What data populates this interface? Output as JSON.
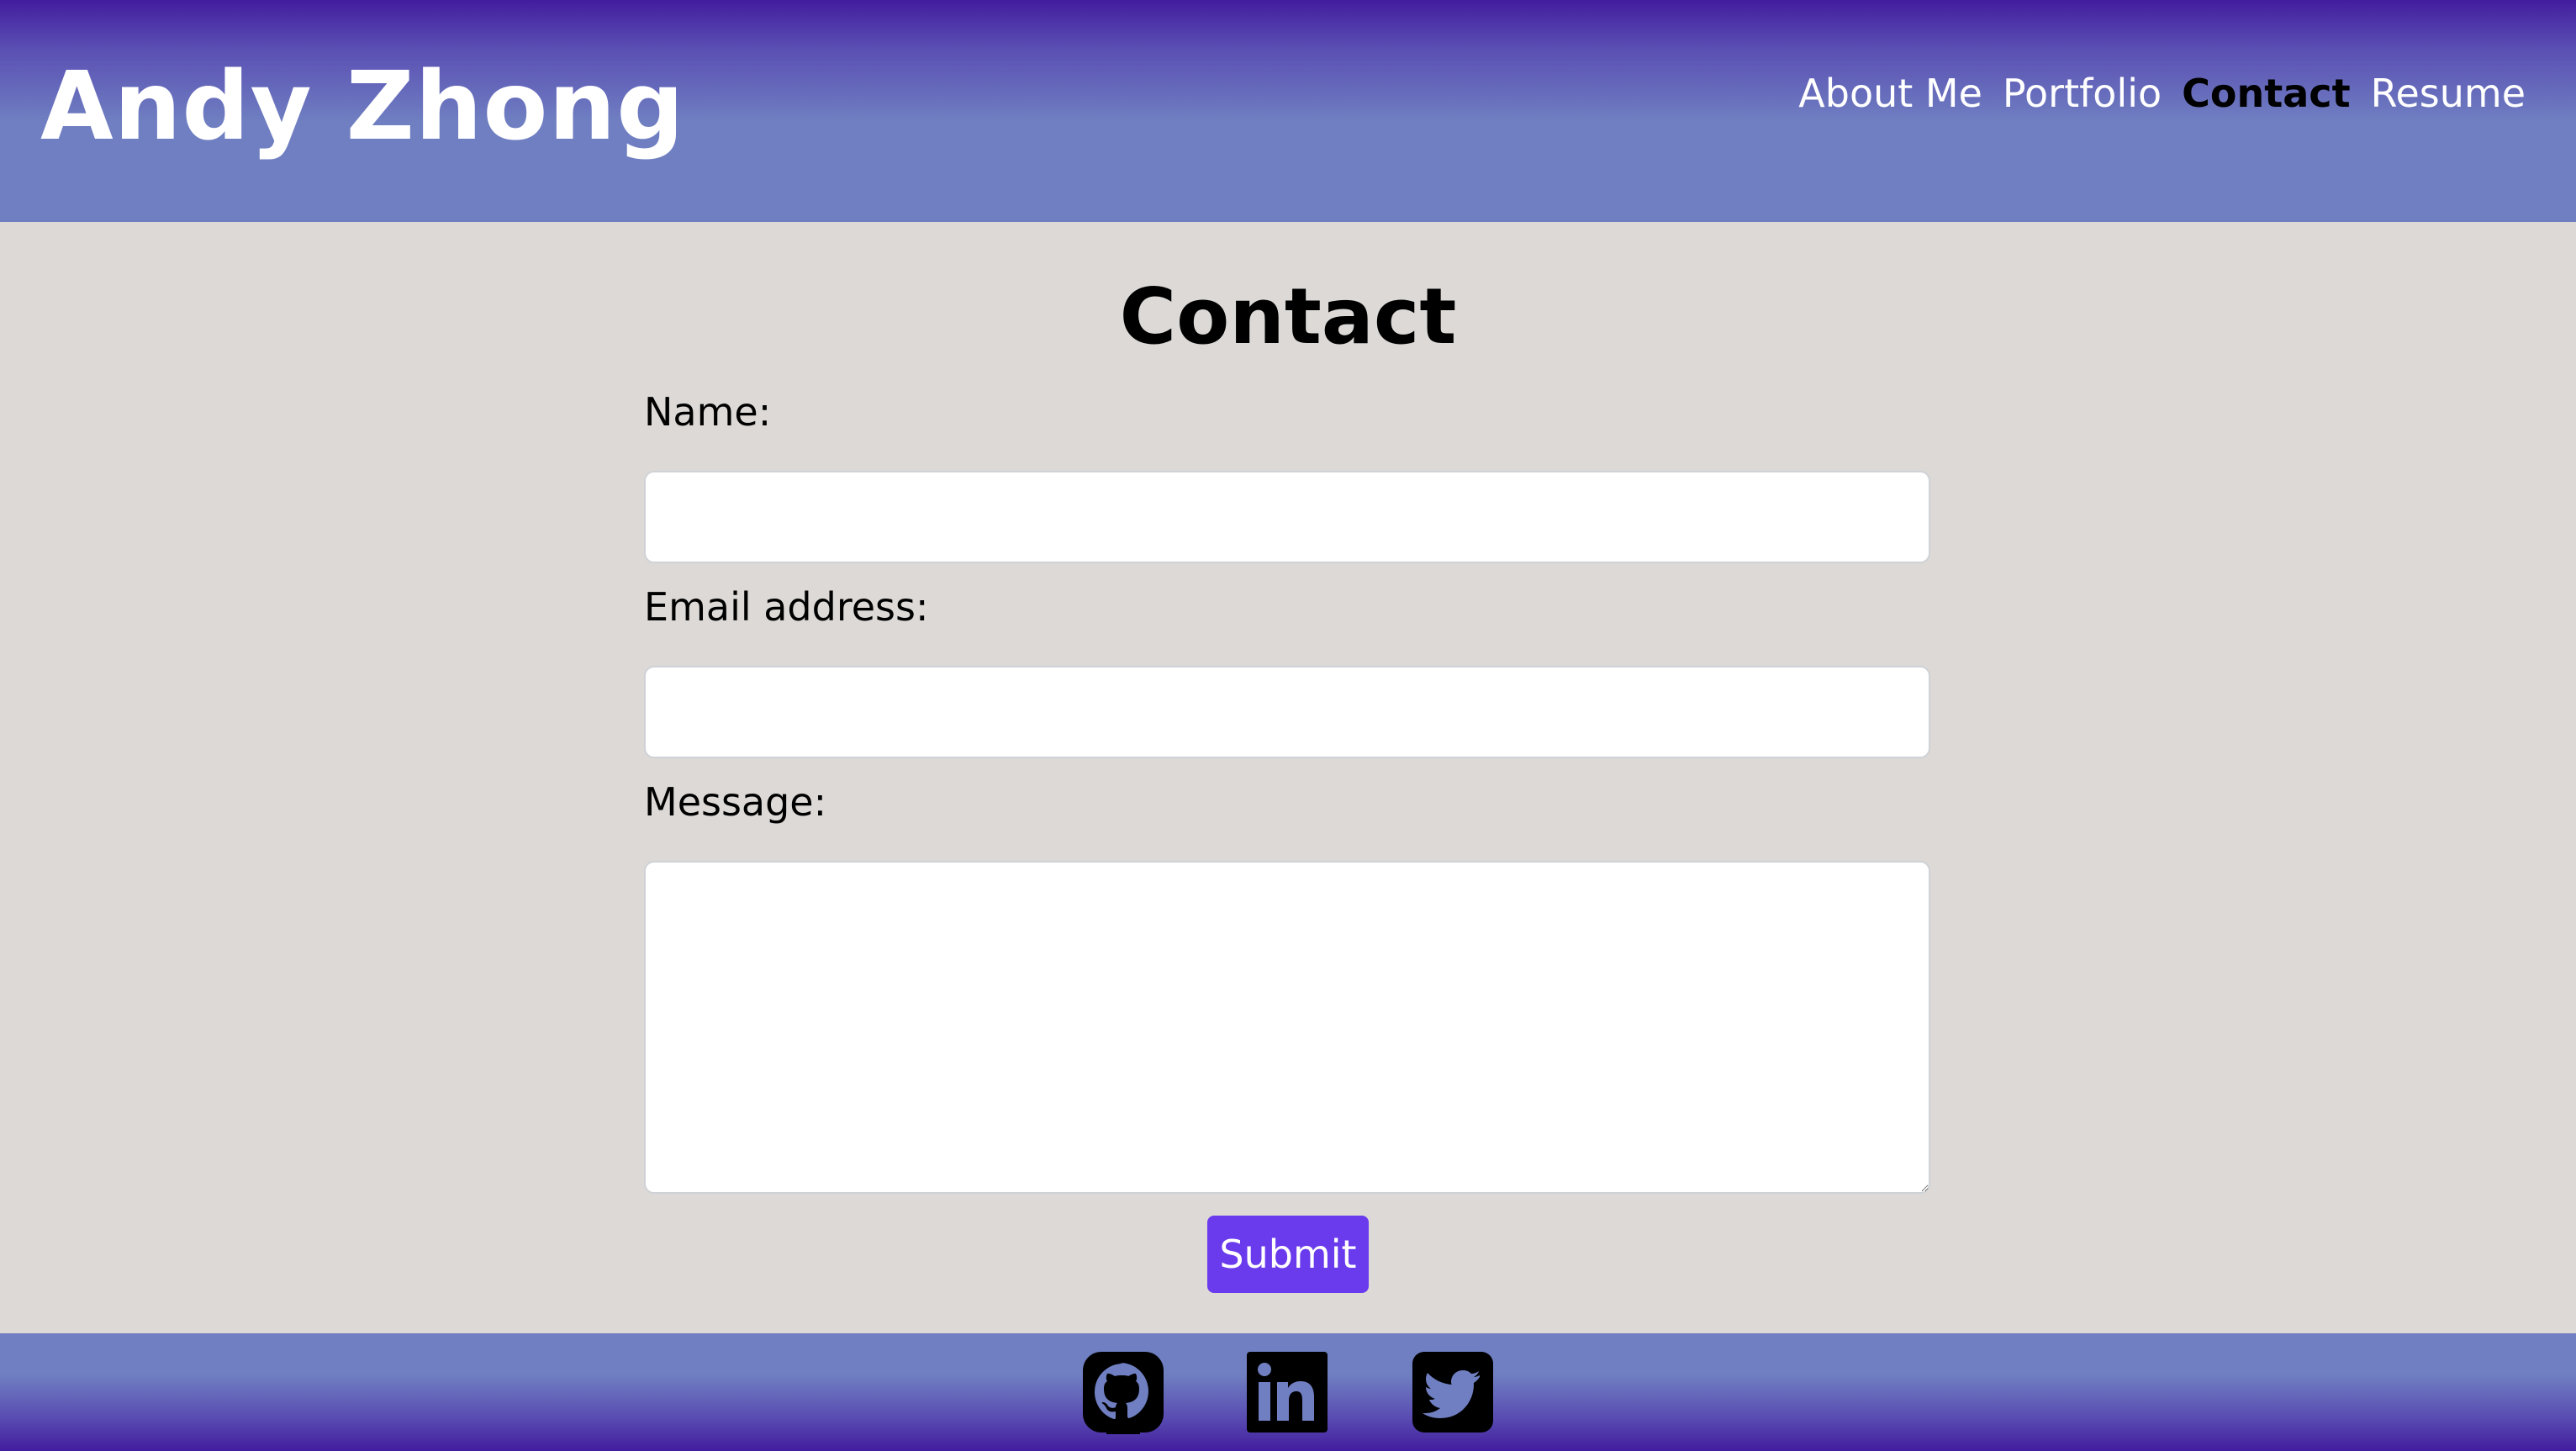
{
  "header": {
    "site_title": "Andy Zhong",
    "nav": [
      {
        "label": "About Me",
        "active": false
      },
      {
        "label": "Portfolio",
        "active": false
      },
      {
        "label": "Contact",
        "active": true
      },
      {
        "label": "Resume",
        "active": false
      }
    ]
  },
  "main": {
    "heading": "Contact",
    "form": {
      "name_label": "Name:",
      "name_value": "",
      "email_label": "Email address:",
      "email_value": "",
      "message_label": "Message:",
      "message_value": "",
      "submit_label": "Submit"
    }
  },
  "footer": {
    "icons": [
      "github-icon",
      "linkedin-icon",
      "twitter-icon"
    ]
  },
  "colors": {
    "header_gradient_top": "#421d9e",
    "header_gradient_bottom": "#6f7fc1",
    "page_background": "#dcd9d6",
    "submit_button": "#6a3aed",
    "nav_active": "#000000",
    "nav_inactive": "#ffffff"
  }
}
